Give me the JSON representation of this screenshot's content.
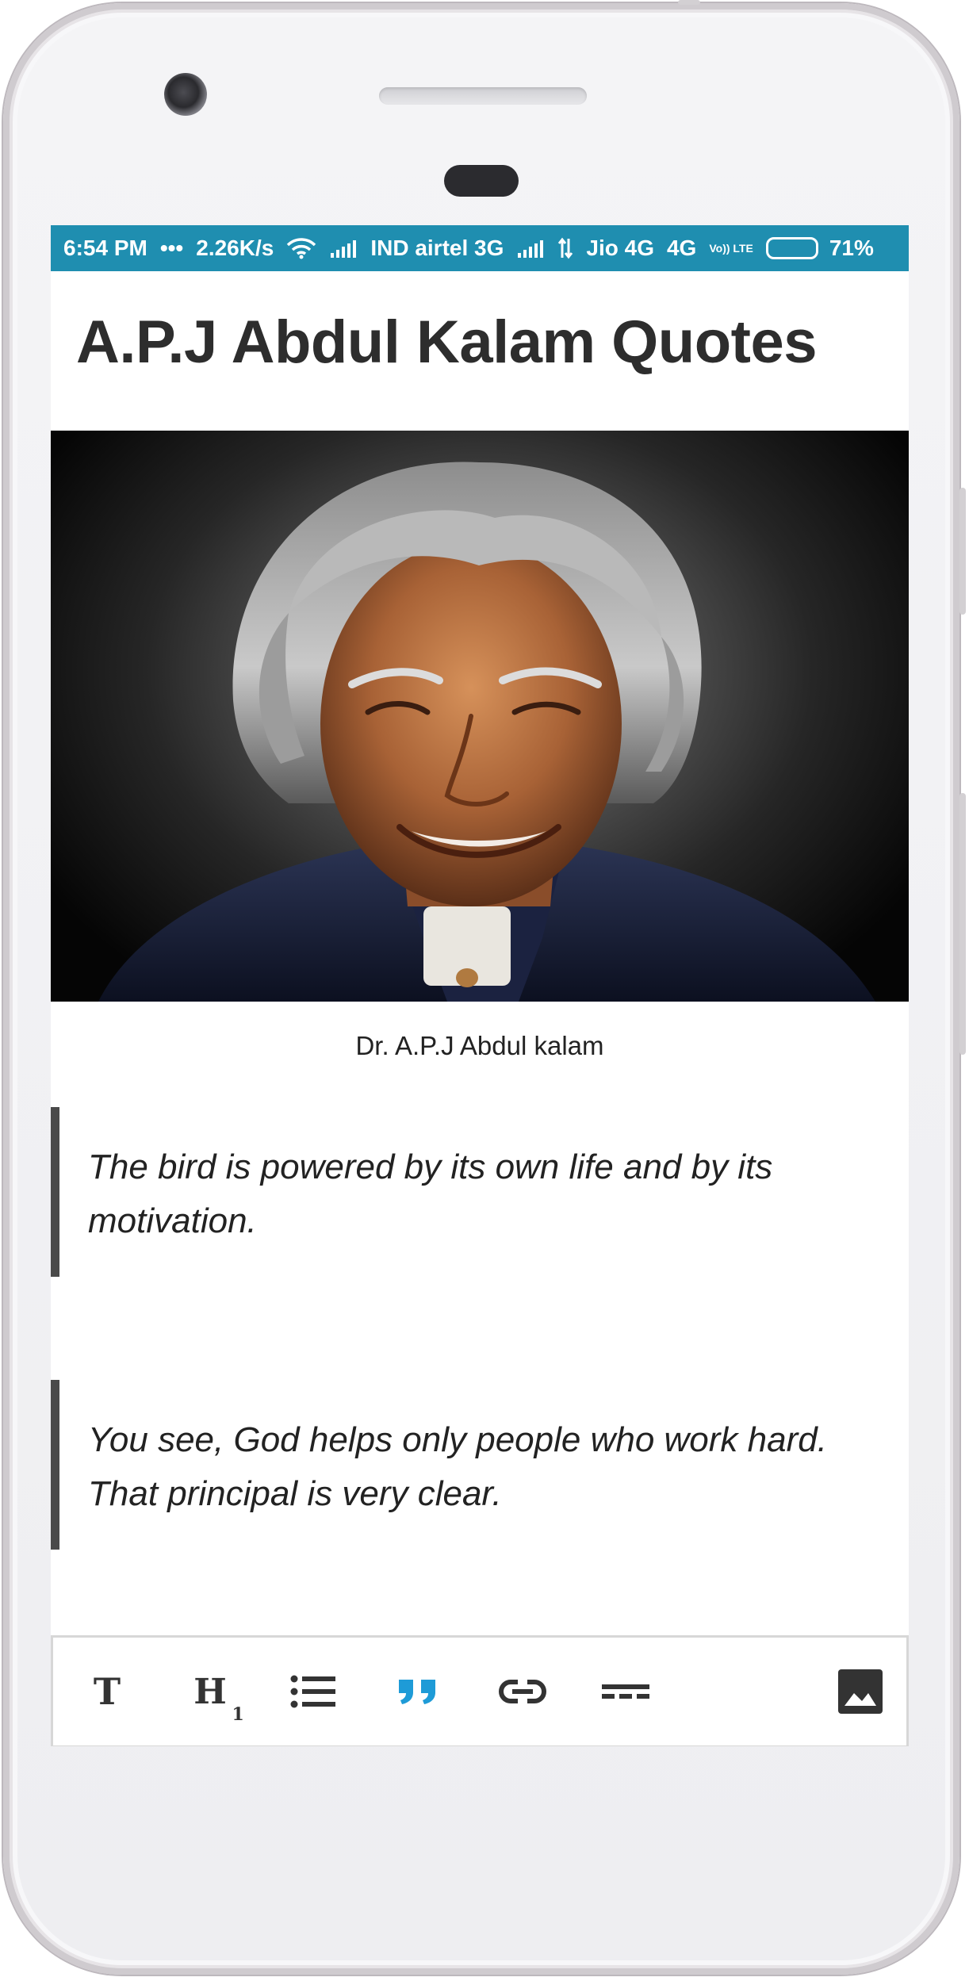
{
  "status_bar": {
    "time": "6:54 PM",
    "dots": "•••",
    "speed": "2.26K/s",
    "carrier1": "IND airtel 3G",
    "carrier2": "Jio 4G",
    "network2": "4G",
    "volte": "Vo)) LTE",
    "battery_percent": "71%",
    "battery_level": 0.71,
    "background_color": "#1f8eb0"
  },
  "app": {
    "title": "A.P.J Abdul Kalam Quotes"
  },
  "hero": {
    "image_icon": "portrait-image",
    "caption": "Dr. A.P.J Abdul kalam"
  },
  "quotes": [
    {
      "text": "The bird is powered by its own life and by its motivation."
    },
    {
      "text": "You see, God helps only people who work hard. That principal is very clear."
    }
  ],
  "toolbar": {
    "text_button": "T",
    "heading_button": "H",
    "heading_sub": "1",
    "icons": [
      "text-format-icon",
      "heading-icon",
      "bullet-list-icon",
      "quote-icon",
      "link-icon",
      "divider-icon",
      "image-icon"
    ],
    "active_icon": "quote-icon",
    "active_color": "#1e9bd7",
    "icon_color": "#333333"
  }
}
